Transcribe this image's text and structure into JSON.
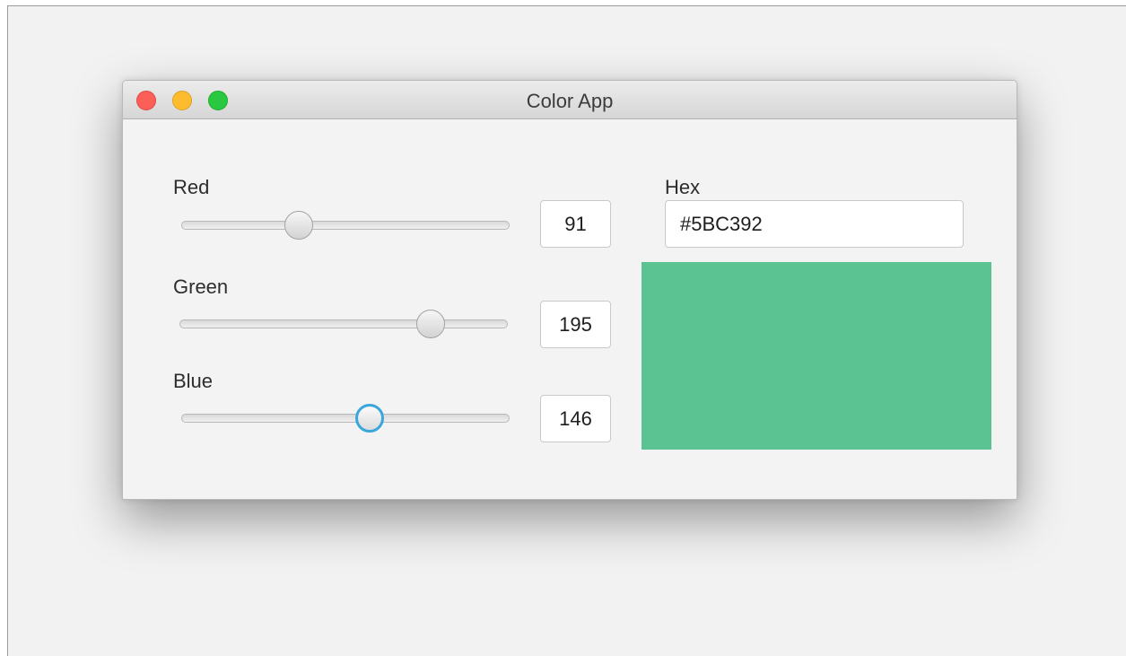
{
  "window": {
    "title": "Color App"
  },
  "controls": {
    "red": {
      "label": "Red",
      "value": "91",
      "fraction": 0.357,
      "focused": false
    },
    "green": {
      "label": "Green",
      "value": "195",
      "fraction": 0.765,
      "focused": false
    },
    "blue": {
      "label": "Blue",
      "value": "146",
      "fraction": 0.573,
      "focused": true
    }
  },
  "hex": {
    "label": "Hex",
    "value": "#5BC392"
  },
  "preview": {
    "color": "#5BC392"
  },
  "icons": {
    "close": "close-traffic-light-icon",
    "minimize": "minimize-traffic-light-icon",
    "maximize": "maximize-traffic-light-icon"
  },
  "colors": {
    "focus_ring": "#39A6DC",
    "close": "#FC5F57",
    "minimize": "#FDBC2E",
    "maximize": "#2AC840"
  }
}
